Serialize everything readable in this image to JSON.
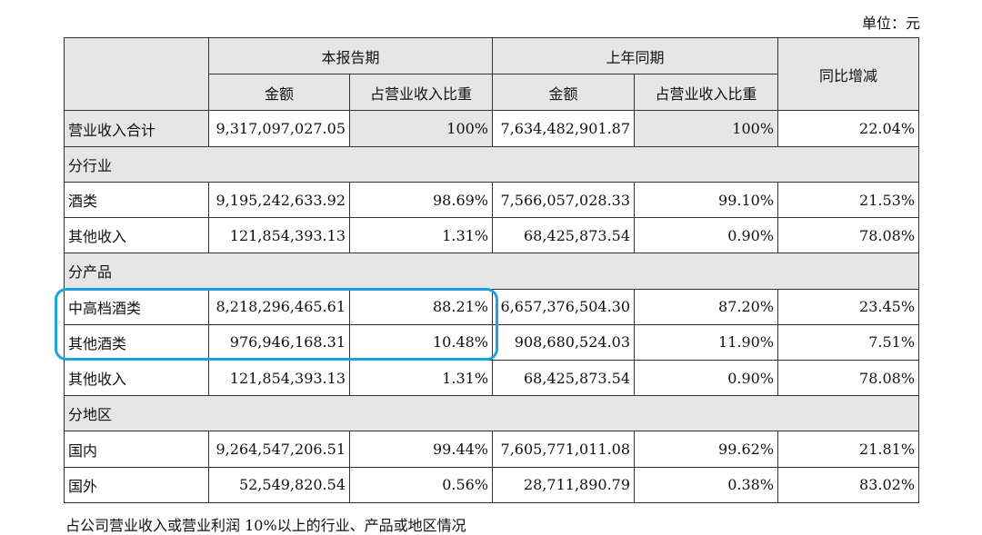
{
  "unit_label": "单位：元",
  "header": {
    "blank": "",
    "current_period": "本报告期",
    "last_year_period": "上年同期",
    "yoy_change": "同比增减",
    "amount": "金额",
    "share": "占营业收入比重"
  },
  "total_row": {
    "label": "营业收入合计",
    "cur_amount": "9,317,097,027.05",
    "cur_share": "100%",
    "prev_amount": "7,634,482,901.87",
    "prev_share": "100%",
    "yoy": "22.04%"
  },
  "sections": [
    {
      "title": "分行业",
      "rows": [
        {
          "label": "酒类",
          "cur_amount": "9,195,242,633.92",
          "cur_share": "98.69%",
          "prev_amount": "7,566,057,028.33",
          "prev_share": "99.10%",
          "yoy": "21.53%"
        },
        {
          "label": "其他收入",
          "cur_amount": "121,854,393.13",
          "cur_share": "1.31%",
          "prev_amount": "68,425,873.54",
          "prev_share": "0.90%",
          "yoy": "78.08%"
        }
      ]
    },
    {
      "title": "分产品",
      "rows": [
        {
          "label": "中高档酒类",
          "cur_amount": "8,218,296,465.61",
          "cur_share": "88.21%",
          "prev_amount": "6,657,376,504.30",
          "prev_share": "87.20%",
          "yoy": "23.45%"
        },
        {
          "label": "其他酒类",
          "cur_amount": "976,946,168.31",
          "cur_share": "10.48%",
          "prev_amount": "908,680,524.03",
          "prev_share": "11.90%",
          "yoy": "7.51%"
        },
        {
          "label": "其他收入",
          "cur_amount": "121,854,393.13",
          "cur_share": "1.31%",
          "prev_amount": "68,425,873.54",
          "prev_share": "0.90%",
          "yoy": "78.08%"
        }
      ]
    },
    {
      "title": "分地区",
      "rows": [
        {
          "label": "国内",
          "cur_amount": "9,264,547,206.51",
          "cur_share": "99.44%",
          "prev_amount": "7,605,771,011.08",
          "prev_share": "99.62%",
          "yoy": "21.81%"
        },
        {
          "label": "国外",
          "cur_amount": "52,549,820.54",
          "cur_share": "0.56%",
          "prev_amount": "28,711,890.79",
          "prev_share": "0.38%",
          "yoy": "83.02%"
        }
      ]
    }
  ],
  "caption": "占公司营业收入或营业利润 10%以上的行业、产品或地区情况",
  "highlight_color": "#1aa3e0"
}
